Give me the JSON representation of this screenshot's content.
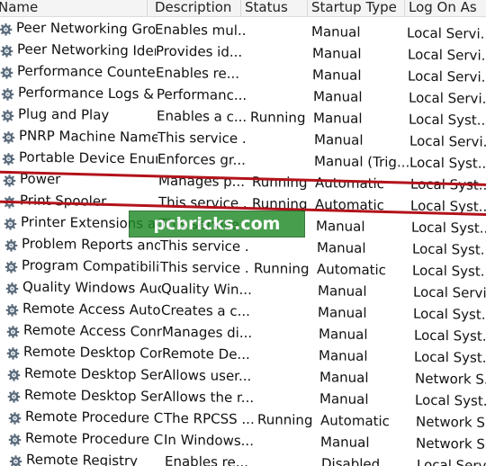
{
  "header": {
    "columns": [
      "Name",
      "Description",
      "Status",
      "Startup Type",
      "Log On As"
    ]
  },
  "icons": {
    "service": "gear-icon",
    "sort": "sort-ascending-icon"
  },
  "services": [
    {
      "name": "Peer Networking Grou...",
      "description": "Enables mul...",
      "status": "",
      "startup": "Manual",
      "logon": "Local Servi..."
    },
    {
      "name": "Peer Networking Iden...",
      "description": "Provides id...",
      "status": "",
      "startup": "Manual",
      "logon": "Local Servi..."
    },
    {
      "name": "Performance Counter ...",
      "description": "Enables re...",
      "status": "",
      "startup": "Manual",
      "logon": "Local Servi..."
    },
    {
      "name": "Performance Logs & ...",
      "description": "Performanc...",
      "status": "",
      "startup": "Manual",
      "logon": "Local Servi..."
    },
    {
      "name": "Plug and Play",
      "description": "Enables a c...",
      "status": "Running",
      "startup": "Manual",
      "logon": "Local Syst..."
    },
    {
      "name": "PNRP Machine Name ...",
      "description": "This service ...",
      "status": "",
      "startup": "Manual",
      "logon": "Local Servi..."
    },
    {
      "name": "Portable Device Enum...",
      "description": "Enforces gr...",
      "status": "",
      "startup": "Manual (Trig...",
      "logon": "Local Syst..."
    },
    {
      "name": "Power",
      "description": "Manages p...",
      "status": "Running",
      "startup": "Automatic",
      "logon": "Local Syst..."
    },
    {
      "name": "Print Spooler",
      "description": "This service ...",
      "status": "Running",
      "startup": "Automatic",
      "logon": "Local Syst..."
    },
    {
      "name": "Printer Extensions and...",
      "description": "This service ...",
      "status": "",
      "startup": "Manual",
      "logon": "Local Syst..."
    },
    {
      "name": "Problem Reports and ...",
      "description": "This service ...",
      "status": "",
      "startup": "Manual",
      "logon": "Local Syst..."
    },
    {
      "name": "Program Compatibilit...",
      "description": "This service ...",
      "status": "Running",
      "startup": "Automatic",
      "logon": "Local Syst..."
    },
    {
      "name": "Quality Windows Audi...",
      "description": "Quality Win...",
      "status": "",
      "startup": "Manual",
      "logon": "Local Servi..."
    },
    {
      "name": "Remote Access Auto ...",
      "description": "Creates a c...",
      "status": "",
      "startup": "Manual",
      "logon": "Local Syst..."
    },
    {
      "name": "Remote Access Conne...",
      "description": "Manages di...",
      "status": "",
      "startup": "Manual",
      "logon": "Local Syst..."
    },
    {
      "name": "Remote Desktop Conf...",
      "description": "Remote De...",
      "status": "",
      "startup": "Manual",
      "logon": "Local Syst..."
    },
    {
      "name": "Remote Desktop Servi...",
      "description": "Allows user...",
      "status": "",
      "startup": "Manual",
      "logon": "Network S..."
    },
    {
      "name": "Remote Desktop Servi...",
      "description": "Allows the r...",
      "status": "",
      "startup": "Manual",
      "logon": "Local Syst..."
    },
    {
      "name": "Remote Procedure Ca...",
      "description": "The RPCSS ...",
      "status": "Running",
      "startup": "Automatic",
      "logon": "Network S..."
    },
    {
      "name": "Remote Procedure Ca...",
      "description": "In Windows...",
      "status": "",
      "startup": "Manual",
      "logon": "Network S..."
    },
    {
      "name": "Remote Registry",
      "description": "Enables re...",
      "status": "",
      "startup": "Disabled",
      "logon": "Local Servi..."
    }
  ],
  "highlight": {
    "row_index": 8,
    "color": "#b3131b"
  },
  "watermark": {
    "text": "pcbricks.com",
    "color": "#1f8a27"
  }
}
